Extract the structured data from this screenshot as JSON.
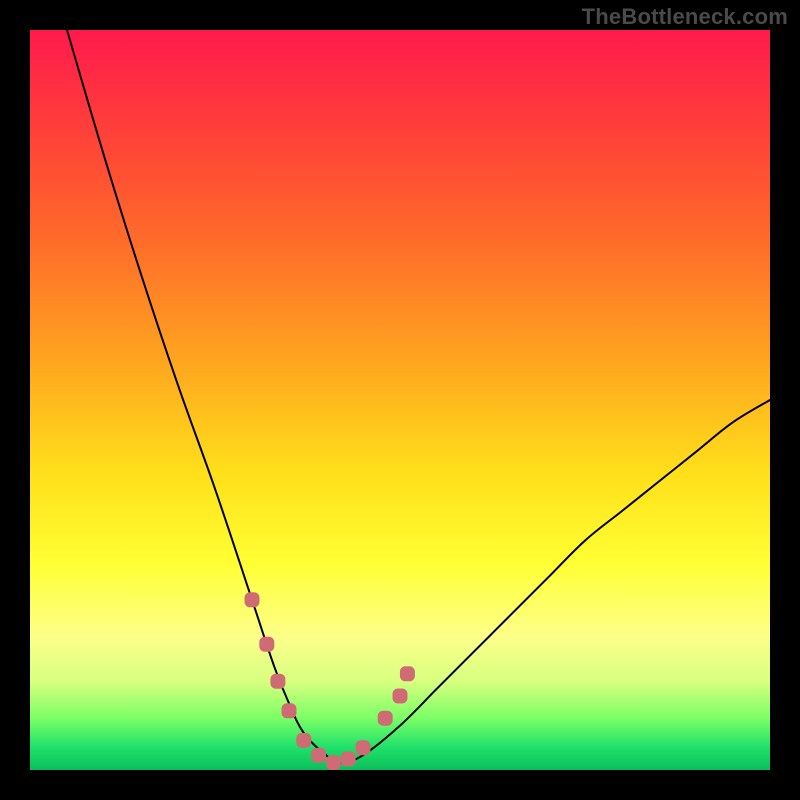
{
  "watermark": "TheBottleneck.com",
  "colors": {
    "line": "#000000",
    "marker_fill": "#cf6b74",
    "marker_stroke": "#cf6b74"
  },
  "chart_data": {
    "type": "line",
    "title": "",
    "xlabel": "",
    "ylabel": "",
    "xlim": [
      0,
      100
    ],
    "ylim": [
      0,
      100
    ],
    "grid": false,
    "legend": false,
    "curve": {
      "x": [
        5,
        10,
        15,
        20,
        25,
        30,
        33,
        35,
        37,
        40,
        42,
        45,
        50,
        55,
        60,
        65,
        70,
        75,
        80,
        85,
        90,
        95,
        100
      ],
      "y": [
        100,
        83,
        67,
        52,
        38,
        23,
        14,
        9,
        5,
        2,
        1,
        2,
        6,
        11,
        16,
        21,
        26,
        31,
        35,
        39,
        43,
        47,
        50
      ]
    },
    "markers": [
      {
        "x": 30,
        "y": 23
      },
      {
        "x": 32,
        "y": 17
      },
      {
        "x": 33.5,
        "y": 12
      },
      {
        "x": 35,
        "y": 8
      },
      {
        "x": 37,
        "y": 4
      },
      {
        "x": 39,
        "y": 2
      },
      {
        "x": 41,
        "y": 1
      },
      {
        "x": 43,
        "y": 1.5
      },
      {
        "x": 45,
        "y": 3
      },
      {
        "x": 48,
        "y": 7
      },
      {
        "x": 50,
        "y": 10
      },
      {
        "x": 51,
        "y": 13
      }
    ]
  }
}
